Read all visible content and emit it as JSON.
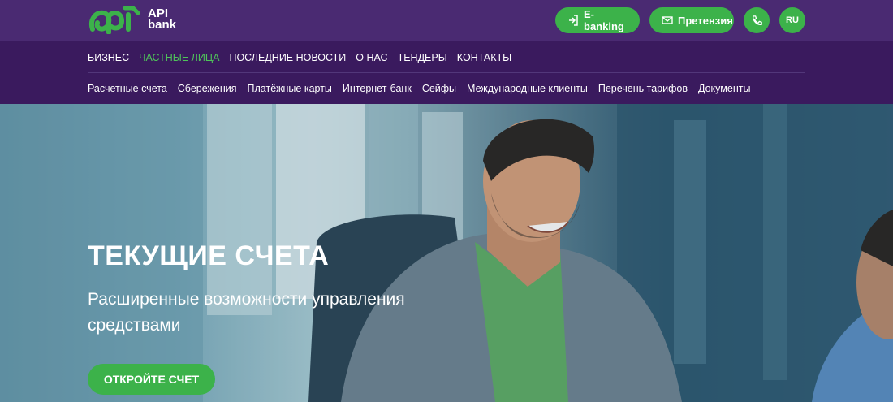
{
  "brand": {
    "logo_mark": "api",
    "logo_line1": "API",
    "logo_line2": "bank",
    "accent": "#3cb24a",
    "topbar_bg": "#4a2a72",
    "nav_bg": "#3a1a5e"
  },
  "top_actions": {
    "ebanking_label": "E-banking",
    "claim_label": "Претензия",
    "phone_icon": "phone-icon",
    "lang_label": "RU"
  },
  "nav_main": [
    {
      "label": "БИЗНЕС",
      "active": false
    },
    {
      "label": "ЧАСТНЫЕ ЛИЦА",
      "active": true
    },
    {
      "label": "ПОСЛЕДНИЕ НОВОСТИ",
      "active": false
    },
    {
      "label": "О НАС",
      "active": false
    },
    {
      "label": "ТЕНДЕРЫ",
      "active": false
    },
    {
      "label": "КОНТАКТЫ",
      "active": false
    }
  ],
  "nav_sub": [
    {
      "label": "Расчетные счета"
    },
    {
      "label": "Сбережения"
    },
    {
      "label": "Платёжные карты"
    },
    {
      "label": "Интернет-банк"
    },
    {
      "label": "Сейфы"
    },
    {
      "label": "Международные клиенты"
    },
    {
      "label": "Перечень тарифов"
    },
    {
      "label": "Документы"
    }
  ],
  "hero": {
    "title": "ТЕКУЩИЕ СЧЕТА",
    "subtitle": "Расширенные возможности управления средствами",
    "cta_label": "ОТКРОЙТЕ СЧЕТ"
  }
}
